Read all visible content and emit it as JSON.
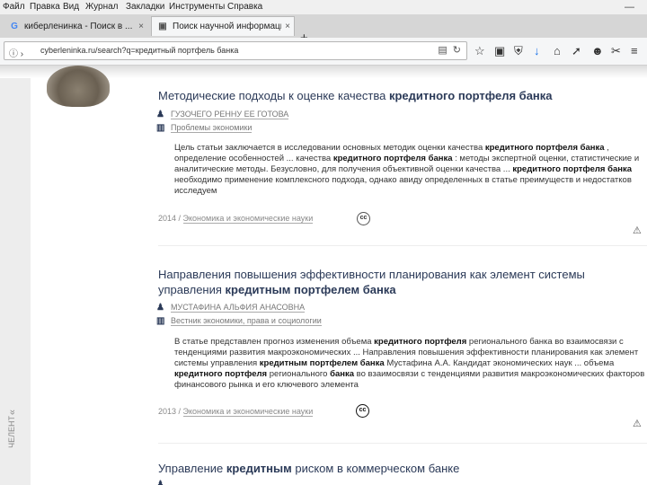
{
  "menu": {
    "items": [
      "Файл",
      "Правка",
      "Вид",
      "Журнал",
      "Закладки",
      "Инструменты",
      "Справка"
    ],
    "minimize": "—"
  },
  "tabs": [
    {
      "favicon": "G",
      "title": "киберленинка - Поиск в ...",
      "close": "×"
    },
    {
      "favicon": "▣",
      "title": "Поиск научной информаци...",
      "close": "×"
    }
  ],
  "new_tab": "+",
  "url": {
    "text": "cyberleninka.ru/search?q=кредитный портфель банка",
    "icons": [
      "lock-icon",
      "reader-icon",
      "reload-icon"
    ]
  },
  "toolbar_icons": [
    "star-icon",
    "library-icon",
    "shield-icon",
    "download-icon",
    "home-icon",
    "send-icon",
    "chat-icon",
    "screenshot-icon",
    "menu-icon"
  ],
  "results": [
    {
      "title_pre": "Методические подходы к оценке качества ",
      "title_bold": "кредитного портфеля банка",
      "title_post": "",
      "author": "ГУЗОЧЕГО РЕННУ ЕЕ ГОТОВА",
      "journal": "Проблемы экономики",
      "snippet": [
        {
          "t": "Цель статьи заключается в исследовании основных методик оценки качества ",
          "b": "кредитного"
        },
        {
          "t": "",
          "b": "портфеля банка"
        },
        {
          "t": ", определение особенностей ... качества ",
          "b": "кредитного портфеля банка"
        },
        {
          "t": ": методы экспертной оценки, статистические и аналитические методы. Безусловно, для получения объективной оценки качества ... ",
          "b": "кредитного портфеля банка"
        },
        {
          "t": " необходимо применение комплексного подхода, однако авиду определенных в статье преимуществ и недостатков исследуем",
          "b": ""
        }
      ],
      "year": "2014",
      "category": "Экономика и экономические науки",
      "cc": "cc"
    },
    {
      "title_pre": "Направления повышения эффективности планирования как элемент системы управления ",
      "title_bold": "кредитным портфелем банка",
      "title_post": "",
      "author": "МУСТАФИНА АЛЬФИЯ АНАСОВНА",
      "journal": "Вестник экономики, права и социологии",
      "snippet": [
        {
          "t": "В статье представлен прогноз изменения объема ",
          "b": "кредитного портфеля"
        },
        {
          "t": " регионального банка во взаимосвязи с тенденциями развития макроэкономических ... Направления повышения эффективности планирования как элемент системы управления ",
          "b": "кредитным портфелем банка"
        },
        {
          "t": " Мустафина А.А. Кандидат экономических наук ... объема ",
          "b": "кредитного портфеля"
        },
        {
          "t": " регионального ",
          "b": "банка"
        },
        {
          "t": " во взаимосвязи с тенденциями развития макроэкономических факторов финансового рынка и его ключевого элемента",
          "b": ""
        }
      ],
      "year": "2013",
      "category": "Экономика и экономические науки",
      "cc": "cc"
    },
    {
      "title_pre": "Управление ",
      "title_bold": "кредитным",
      "title_post": " риском в коммерческом банке"
    }
  ],
  "side": {
    "label": "ЧЕЛЕНТ",
    "chevron": "«"
  },
  "warn_icon": "⚠"
}
